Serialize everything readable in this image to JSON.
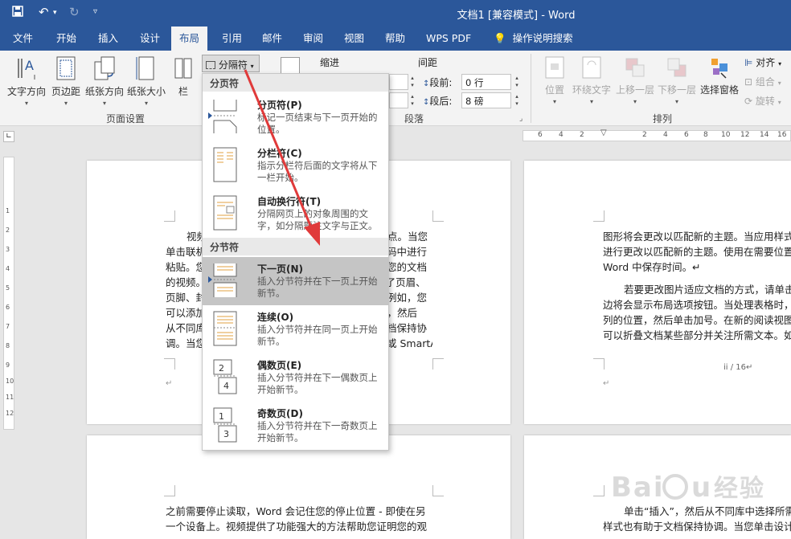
{
  "window": {
    "title": "文档1 [兼容模式]  -  Word"
  },
  "menu": {
    "tabs": [
      "文件",
      "开始",
      "插入",
      "设计",
      "布局",
      "引用",
      "邮件",
      "审阅",
      "视图",
      "帮助",
      "WPS PDF",
      "操作说明搜索"
    ],
    "active": "布局"
  },
  "ribbon": {
    "page_setup": {
      "text_direction": "文字方向",
      "margins": "页边距",
      "orientation": "纸张方向",
      "size": "纸张大小",
      "columns": "栏",
      "breaks": "分隔符",
      "group_label": "页面设置"
    },
    "paragraph": {
      "indent_label": "缩进",
      "spacing_label": "间距",
      "before_label": "段前:",
      "before_value": "0 行",
      "after_label": "段后:",
      "after_value": "8 磅",
      "group_label": "段落"
    },
    "arrange": {
      "position": "位置",
      "wrap_text": "环绕文字",
      "bring_forward": "上移一层",
      "send_backward": "下移一层",
      "selection_pane": "选择窗格",
      "align": "对齐",
      "group": "组合",
      "rotate": "旋转",
      "group_label": "排列"
    }
  },
  "ruler": {
    "ticks": [
      "6",
      "4",
      "2",
      "2",
      "4",
      "6",
      "8",
      "10",
      "12",
      "14",
      "16",
      "18"
    ],
    "vticks": [
      "1",
      "2",
      "3",
      "4",
      "5",
      "6",
      "7",
      "8",
      "9",
      "10",
      "11",
      "12"
    ]
  },
  "dropdown": {
    "section1": "分页符",
    "section2": "分节符",
    "items": [
      {
        "title": "分页符(P)",
        "desc": "标记一页结束与下一页开始的位置。"
      },
      {
        "title": "分栏符(C)",
        "desc": "指示分栏符后面的文字将从下一栏开始。"
      },
      {
        "title": "自动换行符(T)",
        "desc": "分隔网页上的对象周围的文字，如分隔题注文字与正文。"
      },
      {
        "title": "下一页(N)",
        "desc": "插入分节符并在下一页上开始新节。"
      },
      {
        "title": "连续(O)",
        "desc": "插入分节符并在同一页上开始新节。"
      },
      {
        "title": "偶数页(E)",
        "desc": "插入分节符并在下一偶数页上开始新节。"
      },
      {
        "title": "奇数页(D)",
        "desc": "插入分节符并在下一奇数页上开始新节。"
      }
    ]
  },
  "doc": {
    "page1_lines": [
      "视频提供了功能强大的方法帮助您证明您的观点。当您",
      "单击联机视频时，可以在想要添加的视频的嵌入代码中进行",
      "粘贴。您也可以键入一个关键字以联机搜索最适合您的文档",
      "的视频。为使您的文档具有专业外观，Word 提供了页眉、",
      "页脚、封面和文本框设计，这些设计可互为补充。例如，您",
      "可以添加匹配的封面、页眉和提要栏。单击“插入”，然后",
      "从不同库中选择所需元素。主题和样式也有助于文档保持协",
      "调。当您单击设计并选择新的主题时，图片、图表或 SmartArt"
    ],
    "page2_lines": [
      "图形将会更改以匹配新的主题。当应用样式时，您的标题会",
      "进行更改以匹配新的主题。使用在需要位置出现的新按钮在",
      "Word 中保存时间。↵",
      "",
      "若要更改图片适应文档的方式，请单击该图片，图片旁",
      "边将会显示布局选项按钮。当处理表格时，单击要添加行或",
      "列的位置，然后单击加号。在新的阅读视图中阅读更加容易。",
      "可以折叠文档某些部分并关注所需文本。如果在达到结尾处"
    ],
    "page2_footer": "ii  /  16↵",
    "page3_lines": [
      "之前需要停止读取，Word 会记住您的停止位置 - 即使在另",
      "一个设备上。视频提供了功能强大的方法帮助您证明您的观"
    ],
    "page4_lines": [
      "单击“插入”，然后从不同库中选择所需元素。主题和",
      "样式也有助于文档保持协调。当您单击设计并选择新的主题"
    ]
  },
  "watermark": "Baidu 经验",
  "colors": {
    "accent": "#2b579a",
    "arrow": "#e03a3a",
    "selected_item": "#c5c5c5"
  }
}
